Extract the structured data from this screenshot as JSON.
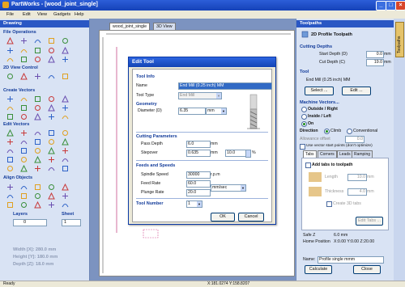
{
  "window": {
    "title": "PartWorks - [wood_joint_single]"
  },
  "menu": [
    "File",
    "Edit",
    "View",
    "Gadgets",
    "Help"
  ],
  "left_panel": {
    "header": "Drawing",
    "sections": [
      "File Operations",
      "2D View Control",
      "Create Vectors",
      "Edit Vectors",
      "Align Objects"
    ],
    "layers_label": "Layers",
    "sheet_label": "Sheet",
    "layer_value": "0",
    "sheet_value": "1",
    "width": "Width  [X]: 280.0 mm",
    "height": "Height [Y]: 180.0 mm",
    "depth": "Depth  [Z]: 18.0 mm"
  },
  "doc_tabs": [
    "wood_joint_single",
    "3D View"
  ],
  "dialog": {
    "title": "Edit Tool",
    "tool_info_header": "Tool Info",
    "name_label": "Name",
    "name_value": "End Mill (0.25 inch) MM",
    "tool_type_label": "Tool Type",
    "tool_type_value": "End Mill",
    "geometry_header": "Geometry",
    "diameter_label": "Diameter (D)",
    "diameter_value": "6.35",
    "diameter_units": "mm",
    "cutting_params_header": "Cutting Parameters",
    "pass_depth_label": "Pass Depth",
    "pass_depth_value": "6.0",
    "pass_depth_units": "mm",
    "stepover_label": "Stepover",
    "stepover_value": "0.635",
    "stepover_units": "mm",
    "stepover_pct_value": "10.0",
    "stepover_pct_units": "%",
    "feeds_header": "Feeds and Speeds",
    "spindle_label": "Spindle Speed",
    "spindle_value": "30000",
    "spindle_units": "r.p.m",
    "feed_label": "Feed Rate",
    "feed_value": "60.0",
    "rate_units": "mm/sec",
    "plunge_label": "Plunge Rate",
    "plunge_value": "20.0",
    "tool_number_label": "Tool Number",
    "tool_number_value": "1",
    "ok_label": "OK",
    "cancel_label": "Cancel"
  },
  "right_panel": {
    "header": "Toolpaths",
    "toolpath_title": "2D Profile Toolpath",
    "cutting_depths": "Cutting Depths",
    "start_depth_label": "Start Depth (D)",
    "start_depth_value": "0.0",
    "cut_depth_label": "Cut Depth (C)",
    "cut_depth_value": "19.0",
    "units": "mm",
    "tool_header": "Tool",
    "tool_value": "End Mill (0.25 inch) MM",
    "select_label": "Select ...",
    "edit_label": "Edit ...",
    "machine_vectors": "Machine Vectors...",
    "outside": "Outside / Right",
    "inside": "Inside / Left",
    "on": "On",
    "direction_label": "Direction",
    "climb": "Climb",
    "conventional": "Conventional",
    "allowance_label": "Allowance offset",
    "allowance_value": "0.0",
    "start_points": "Use vector start points (don't optimize)",
    "tabs": [
      "Tabs",
      "Corners",
      "Leads",
      "Ramping"
    ],
    "add_tabs": "Add tabs to toolpath",
    "length_label": "Length",
    "length_value": "10.0",
    "thickness_label": "Thickness",
    "thickness_value": "4.0",
    "create_3d": "Create 3D tabs",
    "edit_tabs": "Edit Tabs ...",
    "safe_z": "Safe Z",
    "safe_z_value": "6.0 mm",
    "home_label": "Home Position",
    "home_value": "X:0.00 Y:0.00 Z:20.00",
    "name_label": "Name:",
    "name_value": "Profile single mmm",
    "calculate_label": "Calculate",
    "close_label": "Close",
    "side_tab": "Toolpaths"
  },
  "status": {
    "left": "Ready",
    "coords": "X:181.0274 Y:158.8207"
  }
}
